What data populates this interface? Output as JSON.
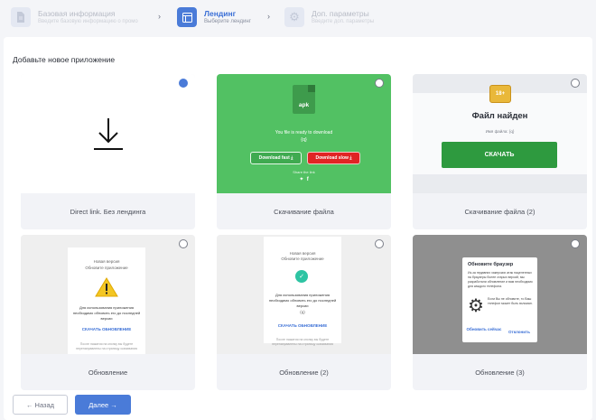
{
  "stepper": {
    "steps": [
      {
        "title": "Базовая информация",
        "subtitle": "Введите базовую информацию о промо",
        "state": "done",
        "icon": "document-icon"
      },
      {
        "title": "Лендинг",
        "subtitle": "Выберите лендинг",
        "state": "active",
        "icon": "layout-icon"
      },
      {
        "title": "Доп. параметры",
        "subtitle": "Введите доп. параметры",
        "state": "pending",
        "icon": "gear-icon"
      }
    ]
  },
  "page": {
    "title": "Добавьте новое приложение"
  },
  "cards": [
    {
      "label": "Direct link. Без лендинга",
      "selected": true
    },
    {
      "label": "Скачивание файла",
      "selected": false
    },
    {
      "label": "Скачивание файла (2)",
      "selected": false
    },
    {
      "label": "Обновление",
      "selected": false
    },
    {
      "label": "Обновление (2)",
      "selected": false
    },
    {
      "label": "Обновление (3)",
      "selected": false
    }
  ],
  "apk_preview": {
    "doc_label": "apk",
    "ready_text": "You file is ready to download",
    "placeholder": "{q}",
    "fast_label": "Download fast",
    "slow_label": "Download slow",
    "share_label": "Share the link"
  },
  "file_found_preview": {
    "badge": "18+",
    "title": "Файл найден",
    "name_line": "Имя файла: {q}",
    "download_label": "СКАЧАТЬ"
  },
  "update_preview_1": {
    "heading1": "Новая версия",
    "heading2": "Обновите приложение",
    "body": "Для использования приложения необходимо обновить его до последней версии",
    "link": "СКАЧАТЬ ОБНОВЛЕНИЕ",
    "fine": "После нажатия на кнопку вы будете перенаправлены на страницу скачивания"
  },
  "update_preview_2": {
    "heading1": "Новая версия",
    "heading2": "Обновите приложение",
    "body": "Для использования приложения необходимо обновить его до последней версии",
    "note": "(q)",
    "link": "СКАЧАТЬ ОБНОВЛЕНИЕ",
    "fine": "После нажатия на кнопку вы будете перенаправлены на страницу скачивания"
  },
  "browser_preview": {
    "title": "Обновите браузер",
    "text": "Из-за недавних хакерских атак нацеленных на браузеры более старых версий, мы разработали обновление и вам необходимо для каждого телефона.",
    "text2": "Если Вы не обновите, то Ваш телефон может быть взломан.",
    "update_label": "Обновить сейчас",
    "cancel_label": "Отклонить"
  },
  "footer": {
    "back_label": "← Назад",
    "next_label": "Далее →"
  },
  "colors": {
    "accent": "#4a7bd8",
    "apk_green": "#52c163",
    "download_green": "#2e9a3f",
    "warning_yellow": "#f3c623"
  }
}
